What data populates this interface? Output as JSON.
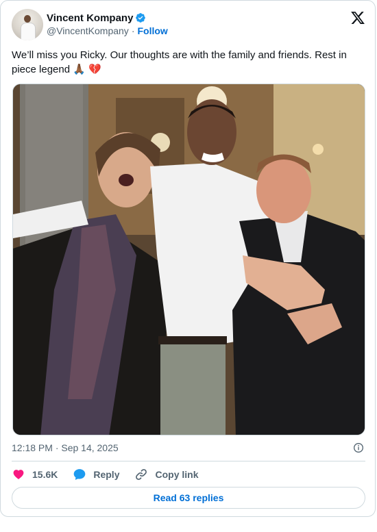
{
  "author": {
    "name": "Vincent Kompany",
    "handle": "@VincentKompany",
    "separator": "·",
    "follow_label": "Follow"
  },
  "tweet": {
    "text": "We’ll miss you Ricky. Our thoughts are with the family and friends. Rest in piece legend",
    "emojis": [
      "🙏🏾",
      "💔"
    ]
  },
  "meta": {
    "timestamp": "12:18 PM · Sep 14, 2025"
  },
  "actions": {
    "likes": "15.6K",
    "reply_label": "Reply",
    "copy_label": "Copy link"
  },
  "replies_button_label": "Read 63 replies",
  "colors": {
    "accent": "#006fd6",
    "like": "#f91880",
    "reply_bubble": "#1d9bf0",
    "verified": "#1d9bf0",
    "text_secondary": "#536471",
    "border": "#cfd9de"
  },
  "icons": [
    "verified-badge-icon",
    "x-logo-icon",
    "info-icon",
    "heart-icon",
    "reply-bubble-icon",
    "link-icon"
  ]
}
